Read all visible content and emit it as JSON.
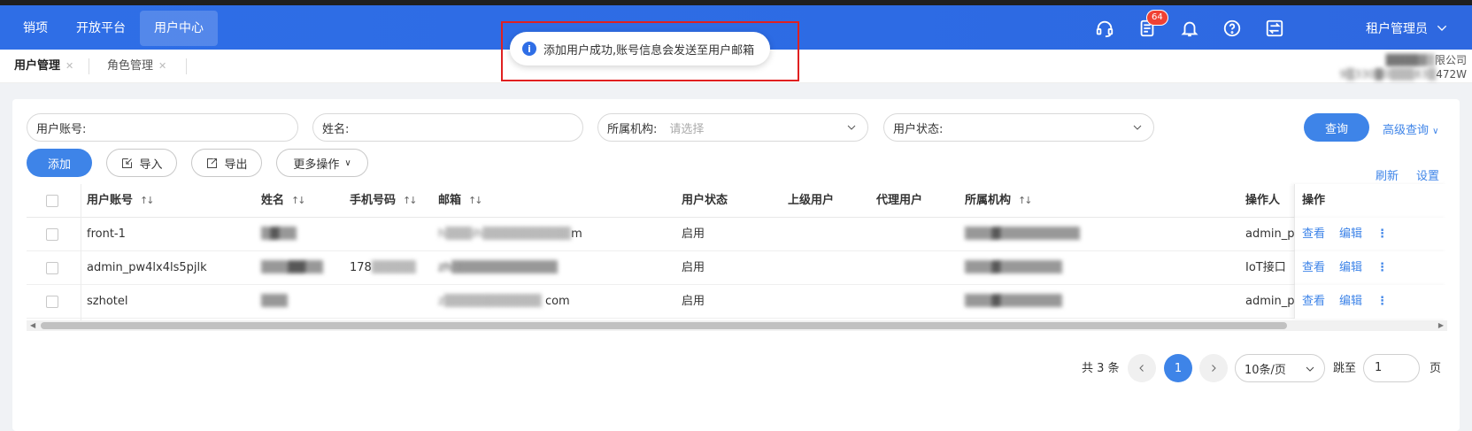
{
  "header": {
    "nav": [
      {
        "label": "销项",
        "active": false
      },
      {
        "label": "开放平台",
        "active": false
      },
      {
        "label": "用户中心",
        "active": true
      }
    ],
    "notification_count": "64",
    "user_role": "租户管理员"
  },
  "toast": {
    "message": "添加用户成功,账号信息会发送至用户邮箱"
  },
  "page_tabs": [
    {
      "label": "用户管理",
      "active": true
    },
    {
      "label": "角色管理",
      "active": false
    }
  ],
  "company": {
    "name_fragment": "限公司",
    "id_fragment": "472W"
  },
  "filters": {
    "account_label": "用户账号:",
    "name_label": "姓名:",
    "org_label": "所属机构:",
    "org_placeholder": "请选择",
    "status_label": "用户状态:",
    "query_button": "查询",
    "advanced_query": "高级查询"
  },
  "toolbar": {
    "add": "添加",
    "import": "导入",
    "export": "导出",
    "more": "更多操作",
    "refresh": "刷新",
    "settings": "设置"
  },
  "table": {
    "columns": {
      "account": "用户账号",
      "name": "姓名",
      "phone": "手机号码",
      "email": "邮箱",
      "status": "用户状态",
      "superior": "上级用户",
      "agent": "代理用户",
      "org": "所属机构",
      "operator": "操作人",
      "actions": "操作"
    },
    "rows": [
      {
        "account": "front-1",
        "status": "启用",
        "operator": "admin_p",
        "email_tail": "m"
      },
      {
        "account": "admin_pw4lx4ls5pjlk",
        "status": "启用",
        "operator": "IoT接口",
        "phone_head": "178"
      },
      {
        "account": "szhotel",
        "status": "启用",
        "operator": "admin_p",
        "email_tail": "com"
      }
    ],
    "view_label": "查看",
    "edit_label": "编辑",
    "more_label": "⋮"
  },
  "pagination": {
    "total": "共 3 条",
    "current_page": "1",
    "page_size": "10条/页",
    "jump_label": "跳至",
    "jump_value": "1",
    "page_unit": "页"
  },
  "colors": {
    "primary": "#3e84e8",
    "header": "#2f6ee6",
    "badge": "#f04134",
    "highlight": "#e02020"
  }
}
